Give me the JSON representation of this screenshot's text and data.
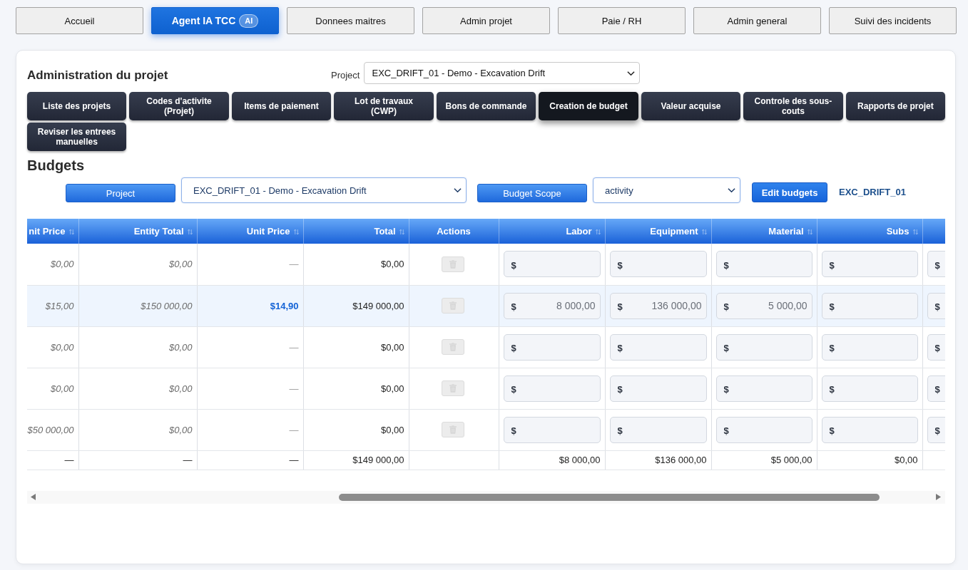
{
  "nav": [
    {
      "label": "Accueil",
      "selected": false
    },
    {
      "label": "Agent IA TCC",
      "selected": true,
      "badge": "AI"
    },
    {
      "label": "Donnees maitres",
      "selected": false
    },
    {
      "label": "Admin projet",
      "selected": false
    },
    {
      "label": "Paie / RH",
      "selected": false
    },
    {
      "label": "Admin general",
      "selected": false
    },
    {
      "label": "Suivi des incidents",
      "selected": false
    }
  ],
  "page": {
    "title": "Administration du projet",
    "project_label": "Project",
    "project_value": "EXC_DRIFT_01 - Demo - Excavation Drift"
  },
  "modules": [
    {
      "label": "Liste des projets",
      "selected": false
    },
    {
      "label": "Codes d'activite (Projet)",
      "selected": false
    },
    {
      "label": "Items de paiement",
      "selected": false
    },
    {
      "label": "Lot de travaux (CWP)",
      "selected": false
    },
    {
      "label": "Bons de commande",
      "selected": false
    },
    {
      "label": "Creation de budget",
      "selected": true
    },
    {
      "label": "Valeur acquise",
      "selected": false
    },
    {
      "label": "Controle des sous-couts",
      "selected": false
    },
    {
      "label": "Rapports de projet",
      "selected": false
    },
    {
      "label": "Reviser les entrees manuelles",
      "selected": false
    }
  ],
  "budgets": {
    "title": "Budgets",
    "project_button": "Project",
    "project_value": "EXC_DRIFT_01 - Demo - Excavation Drift",
    "scope_button": "Budget Scope",
    "scope_value": "activity",
    "edit_button": "Edit budgets",
    "project_code": "EXC_DRIFT_01"
  },
  "table": {
    "columns": [
      {
        "label": "nit Price",
        "sortable": true
      },
      {
        "label": "Entity Total",
        "sortable": true
      },
      {
        "label": "Unit Price",
        "sortable": true
      },
      {
        "label": "Total",
        "sortable": true
      },
      {
        "label": "Actions",
        "sortable": false
      },
      {
        "label": "Labor",
        "sortable": true
      },
      {
        "label": "Equipment",
        "sortable": true
      },
      {
        "label": "Material",
        "sortable": true
      },
      {
        "label": "Subs",
        "sortable": true
      },
      {
        "sortable": false
      }
    ],
    "rows": [
      {
        "selected": false,
        "cells": [
          {
            "kind": "muted",
            "text": "$0,00"
          },
          {
            "kind": "muted",
            "text": "$0,00"
          },
          {
            "kind": "dim",
            "text": "—"
          },
          {
            "kind": "plain",
            "text": "$0,00"
          },
          {
            "kind": "action",
            "disabled": true
          },
          {
            "kind": "input",
            "prefix": "$"
          },
          {
            "kind": "input",
            "prefix": "$"
          },
          {
            "kind": "input",
            "prefix": "$"
          },
          {
            "kind": "input",
            "prefix": "$"
          },
          {
            "kind": "input",
            "prefix": "$"
          }
        ]
      },
      {
        "selected": true,
        "cells": [
          {
            "kind": "muted",
            "text": "$15,00"
          },
          {
            "kind": "muted",
            "text": "$150 000,00"
          },
          {
            "kind": "accent",
            "text": "$14,90"
          },
          {
            "kind": "plain",
            "text": "$149 000,00"
          },
          {
            "kind": "action",
            "disabled": true
          },
          {
            "kind": "input",
            "prefix": "$",
            "value": "8 000,00"
          },
          {
            "kind": "input",
            "prefix": "$",
            "value": "136 000,00"
          },
          {
            "kind": "input",
            "prefix": "$",
            "value": "5 000,00"
          },
          {
            "kind": "input",
            "prefix": "$"
          },
          {
            "kind": "input",
            "prefix": "$"
          }
        ]
      },
      {
        "selected": false,
        "cells": [
          {
            "kind": "muted",
            "text": "$0,00"
          },
          {
            "kind": "muted",
            "text": "$0,00"
          },
          {
            "kind": "dim",
            "text": "—"
          },
          {
            "kind": "plain",
            "text": "$0,00"
          },
          {
            "kind": "action",
            "disabled": true
          },
          {
            "kind": "input",
            "prefix": "$"
          },
          {
            "kind": "input",
            "prefix": "$"
          },
          {
            "kind": "input",
            "prefix": "$"
          },
          {
            "kind": "input",
            "prefix": "$"
          },
          {
            "kind": "input",
            "prefix": "$"
          }
        ]
      },
      {
        "selected": false,
        "cells": [
          {
            "kind": "muted",
            "text": "$0,00"
          },
          {
            "kind": "muted",
            "text": "$0,00"
          },
          {
            "kind": "dim",
            "text": "—"
          },
          {
            "kind": "plain",
            "text": "$0,00"
          },
          {
            "kind": "action",
            "disabled": true
          },
          {
            "kind": "input",
            "prefix": "$"
          },
          {
            "kind": "input",
            "prefix": "$"
          },
          {
            "kind": "input",
            "prefix": "$"
          },
          {
            "kind": "input",
            "prefix": "$"
          },
          {
            "kind": "input",
            "prefix": "$"
          }
        ]
      },
      {
        "selected": false,
        "cells": [
          {
            "kind": "muted",
            "text": "$50 000,00"
          },
          {
            "kind": "muted",
            "text": "$0,00"
          },
          {
            "kind": "dim",
            "text": "—"
          },
          {
            "kind": "plain",
            "text": "$0,00"
          },
          {
            "kind": "action",
            "disabled": true
          },
          {
            "kind": "input",
            "prefix": "$"
          },
          {
            "kind": "input",
            "prefix": "$"
          },
          {
            "kind": "input",
            "prefix": "$"
          },
          {
            "kind": "input",
            "prefix": "$"
          },
          {
            "kind": "input",
            "prefix": "$"
          }
        ]
      }
    ],
    "footer": {
      "cells": [
        {
          "kind": "plain",
          "text": "—"
        },
        {
          "kind": "plain",
          "text": "—"
        },
        {
          "kind": "plain",
          "text": "—"
        },
        {
          "kind": "plain",
          "text": "$149 000,00"
        },
        {
          "kind": "blank"
        },
        {
          "kind": "plain",
          "text": "$8 000,00"
        },
        {
          "kind": "plain",
          "text": "$136 000,00"
        },
        {
          "kind": "plain",
          "text": "$5 000,00"
        },
        {
          "kind": "plain",
          "text": "$0,00"
        },
        {
          "kind": "blank"
        }
      ]
    }
  }
}
